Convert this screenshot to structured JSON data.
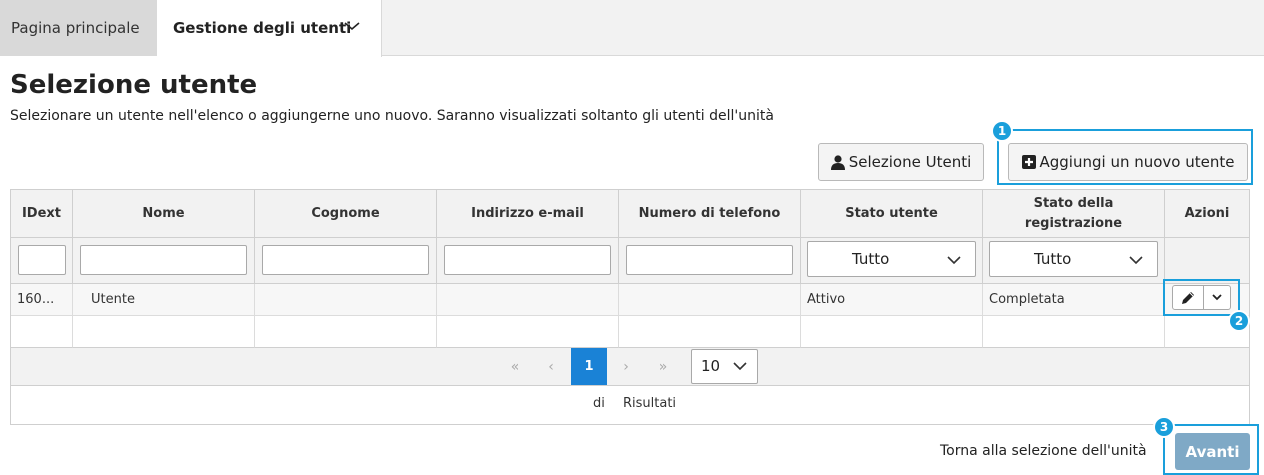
{
  "nav": {
    "home_label": "Pagina principale",
    "users_label": "Gestione degli utenti"
  },
  "page": {
    "title": "Selezione utente",
    "subtitle": "Selezionare un utente nell'elenco o aggiungerne uno nuovo. Saranno visualizzati soltanto gli utenti dell'unità"
  },
  "toolbar": {
    "select_users_label": "Selezione Utenti",
    "add_user_label": "Aggiungi un nuovo utente"
  },
  "table": {
    "headers": [
      "IDext",
      "Nome",
      "Cognome",
      "Indirizzo e-mail",
      "Numero di telefono",
      "Stato utente",
      "Stato della registrazione",
      "Azioni"
    ],
    "filters": {
      "status_value": "Tutto",
      "registration_value": "Tutto"
    },
    "rows": [
      [
        "160...",
        "Utente",
        "",
        "",
        "",
        "Attivo",
        "Completata",
        ""
      ]
    ]
  },
  "pagination": {
    "first": "«",
    "prev": "‹",
    "current_page": "1",
    "next": "›",
    "last": "»",
    "page_size": "10",
    "results_of": "di",
    "results_label": "Risultati"
  },
  "callouts": [
    "1",
    "2",
    "3"
  ],
  "footer": {
    "back_label": "Torna alla selezione dell'unità",
    "next_label": "Avanti"
  },
  "colors": {
    "accent": "#1a9fdb",
    "current_page": "#1a82d6",
    "next_button": "#7fa9c6"
  }
}
